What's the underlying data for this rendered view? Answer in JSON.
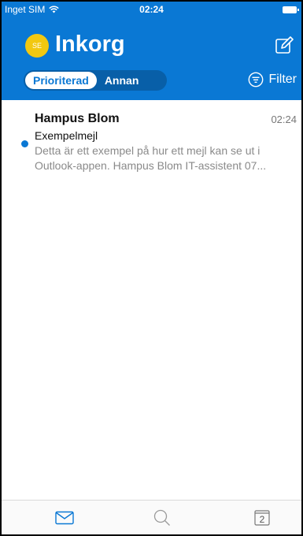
{
  "status_bar": {
    "carrier": "Inget SIM",
    "time": "02:24"
  },
  "header": {
    "avatar_initials": "SE",
    "title": "Inkorg",
    "tabs": [
      {
        "label": "Prioriterad",
        "selected": true
      },
      {
        "label": "Annan",
        "selected": false
      }
    ],
    "filter_label": "Filter"
  },
  "messages": [
    {
      "sender": "Hampus Blom",
      "time": "02:24",
      "subject": "Exempelmejl",
      "preview": "Detta är ett exempel på hur ett mejl kan se ut i\nOutlook-appen. Hampus Blom IT-assistent 07...",
      "unread": true
    }
  ],
  "tabbar": {
    "calendar_day": "2",
    "icons": [
      "mail-icon",
      "search-icon",
      "calendar-icon"
    ]
  },
  "colors": {
    "brand_blue": "#0a78d4",
    "avatar_yellow": "#f2c811"
  }
}
